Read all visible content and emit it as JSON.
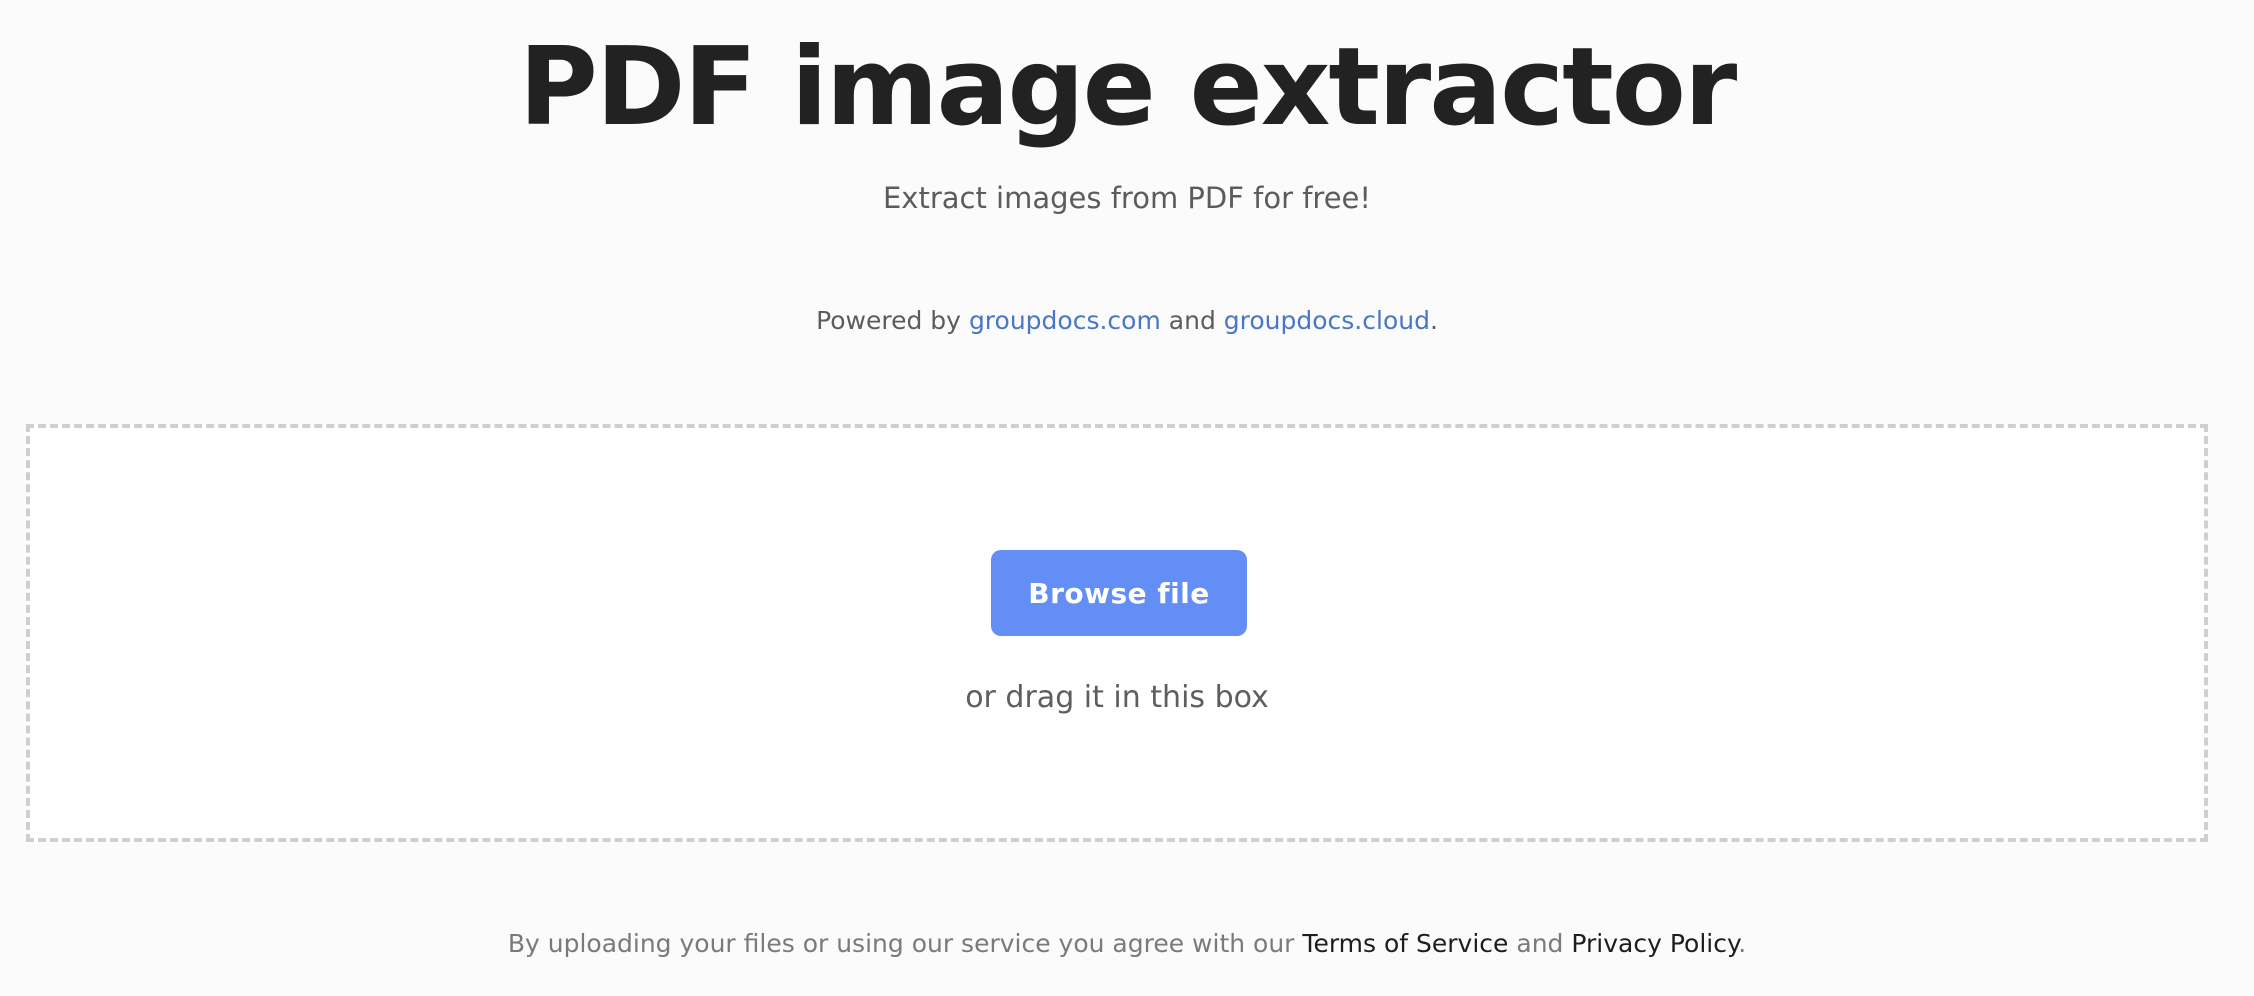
{
  "header": {
    "title": "PDF image extractor",
    "subtitle": "Extract images from PDF for free!"
  },
  "powered_by": {
    "prefix": "Powered by ",
    "link1": "groupdocs.com",
    "middle": " and ",
    "link2": "groupdocs.cloud",
    "suffix": "."
  },
  "upload": {
    "button_label": "Browse file",
    "drag_hint": "or drag it in this box"
  },
  "footer": {
    "prefix": "By uploading your files or using our service you agree with our ",
    "terms_link": "Terms of Service",
    "middle": " and ",
    "privacy_link": "Privacy Policy",
    "suffix": "."
  },
  "colors": {
    "background": "#fbfbfb",
    "button": "#638ef6",
    "link": "#4a76c8",
    "title": "#222222"
  }
}
